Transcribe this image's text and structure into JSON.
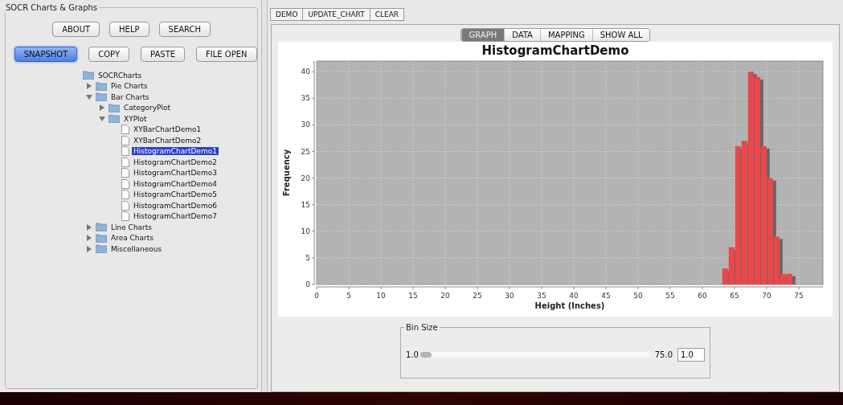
{
  "left_panel": {
    "title": "SOCR Charts & Graphs",
    "button_rows": [
      [
        {
          "label": "ABOUT",
          "selected": false
        },
        {
          "label": "HELP",
          "selected": false
        },
        {
          "label": "SEARCH",
          "selected": false
        }
      ],
      [
        {
          "label": "SNAPSHOT",
          "selected": true
        },
        {
          "label": "COPY",
          "selected": false
        },
        {
          "label": "PASTE",
          "selected": false
        },
        {
          "label": "FILE OPEN",
          "selected": false
        }
      ]
    ],
    "tree": {
      "label": "SOCRCharts",
      "kind": "folder",
      "selected": false,
      "children": [
        {
          "label": "Pie Charts",
          "kind": "folder",
          "expanded": false,
          "selected": false
        },
        {
          "label": "Bar Charts",
          "kind": "folder",
          "expanded": true,
          "selected": false,
          "children": [
            {
              "label": "CategoryPlot",
              "kind": "folder",
              "expanded": false,
              "selected": false
            },
            {
              "label": "XYPlot",
              "kind": "folder",
              "expanded": true,
              "selected": false,
              "children": [
                {
                  "label": "XYBarChartDemo1",
                  "kind": "file",
                  "selected": false
                },
                {
                  "label": "XYBarChartDemo2",
                  "kind": "file",
                  "selected": false
                },
                {
                  "label": "HistogramChartDemo1",
                  "kind": "file",
                  "selected": true
                },
                {
                  "label": "HistogramChartDemo2",
                  "kind": "file",
                  "selected": false
                },
                {
                  "label": "HistogramChartDemo3",
                  "kind": "file",
                  "selected": false
                },
                {
                  "label": "HistogramChartDemo4",
                  "kind": "file",
                  "selected": false
                },
                {
                  "label": "HistogramChartDemo5",
                  "kind": "file",
                  "selected": false
                },
                {
                  "label": "HistogramChartDemo6",
                  "kind": "file",
                  "selected": false
                },
                {
                  "label": "HistogramChartDemo7",
                  "kind": "file",
                  "selected": false
                }
              ]
            }
          ]
        },
        {
          "label": "Line Charts",
          "kind": "folder",
          "expanded": false,
          "selected": false
        },
        {
          "label": "Area Charts",
          "kind": "folder",
          "expanded": false,
          "selected": false
        },
        {
          "label": "Miscellaneous",
          "kind": "folder",
          "expanded": false,
          "selected": false
        }
      ]
    }
  },
  "toolbar": [
    "DEMO",
    "UPDATE_CHART",
    "CLEAR"
  ],
  "view_tabs": [
    {
      "label": "GRAPH",
      "selected": true
    },
    {
      "label": "DATA",
      "selected": false
    },
    {
      "label": "MAPPING",
      "selected": false
    },
    {
      "label": "SHOW ALL",
      "selected": false
    }
  ],
  "chart": {
    "chart_data": {
      "type": "bar",
      "title": "HistogramChartDemo",
      "xlabel": "Height (Inches)",
      "ylabel": "Frequency",
      "x": [
        63.6,
        64.6,
        65.6,
        66.6,
        67.6,
        68.6,
        69.6,
        70.6,
        71.6,
        72.6,
        73.6
      ],
      "series": [
        {
          "color": "#e8484a",
          "values": [
            3,
            7,
            26,
            27,
            40,
            39,
            26,
            20,
            9,
            2,
            2
          ]
        }
      ],
      "grid": true,
      "xlim": [
        0,
        78.75
      ],
      "ylim": [
        0,
        42
      ],
      "xticks": [
        0,
        5,
        10,
        15,
        20,
        25,
        30,
        35,
        40,
        45,
        50,
        55,
        60,
        65,
        70,
        75
      ],
      "yticks": [
        0,
        5,
        10,
        15,
        20,
        25,
        30,
        35,
        40
      ]
    }
  },
  "bin_size": {
    "title": "Bin Size",
    "min_label": "1.0",
    "max_label": "75.0",
    "level": 0,
    "value": "1.0"
  }
}
